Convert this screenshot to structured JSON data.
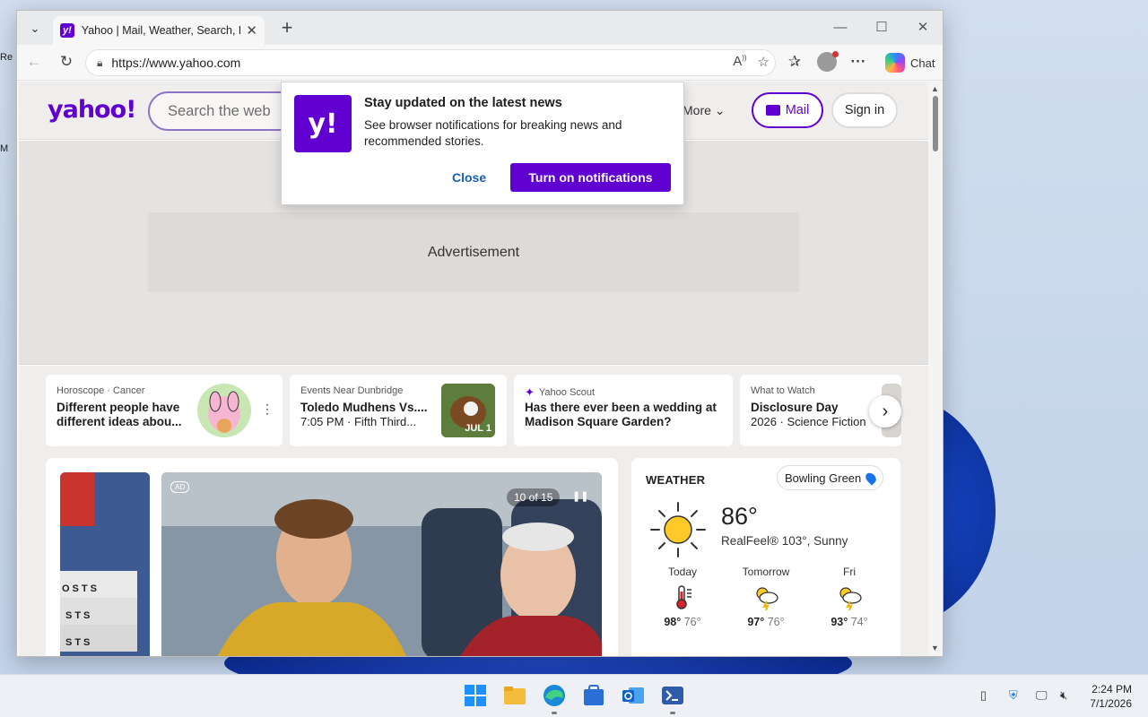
{
  "browser": {
    "tab_title": "Yahoo | Mail, Weather, Search, Politics",
    "url": "https://www.yahoo.com",
    "chat_label": "Chat"
  },
  "yahoo": {
    "logo": "yahoo!",
    "search_placeholder": "Search the web",
    "more_label": "More",
    "mail_label": "Mail",
    "signin_label": "Sign in",
    "ad_label": "Advertisement"
  },
  "notification": {
    "logo": "y!",
    "title": "Stay updated on the latest news",
    "body": "See browser notifications for breaking news and recommended stories.",
    "close_label": "Close",
    "turn_on_label": "Turn on notifications"
  },
  "cards": [
    {
      "kicker": "Horoscope · Cancer",
      "title": "Different people have different ideas abou..."
    },
    {
      "kicker": "Events Near Dunbridge",
      "title": "Toledo Mudhens Vs....",
      "subtitle": "7:05 PM · Fifth Third...",
      "badge": "JUL 1"
    },
    {
      "kicker": "Yahoo Scout",
      "title": "Has there ever been a wedding at Madison Square Garden?"
    },
    {
      "kicker": "What to Watch",
      "title": "Disclosure Day",
      "subtitle": "2026 · Science Fiction"
    }
  ],
  "slideshow": {
    "ad_badge": "AD",
    "counter": "10 of 15",
    "side_text": [
      "OSTS",
      "STS",
      "STS"
    ]
  },
  "weather": {
    "title": "WEATHER",
    "location": "Bowling Green",
    "temp": "86°",
    "feel": "RealFeel® 103°, Sunny",
    "days": [
      {
        "label": "Today",
        "hi": "98°",
        "lo": "76°",
        "icon": "thermometer-icon"
      },
      {
        "label": "Tomorrow",
        "hi": "97°",
        "lo": "76°",
        "icon": "storm-sun-icon"
      },
      {
        "label": "Fri",
        "hi": "93°",
        "lo": "74°",
        "icon": "storm-sun-icon"
      }
    ]
  },
  "taskbar": {
    "time": "2:24 PM",
    "date": "7/1/2026"
  },
  "desktop_fragments": [
    "Re",
    "M"
  ],
  "colors": {
    "yahoo_purple": "#6001d2",
    "link_blue": "#1a5fb4"
  }
}
